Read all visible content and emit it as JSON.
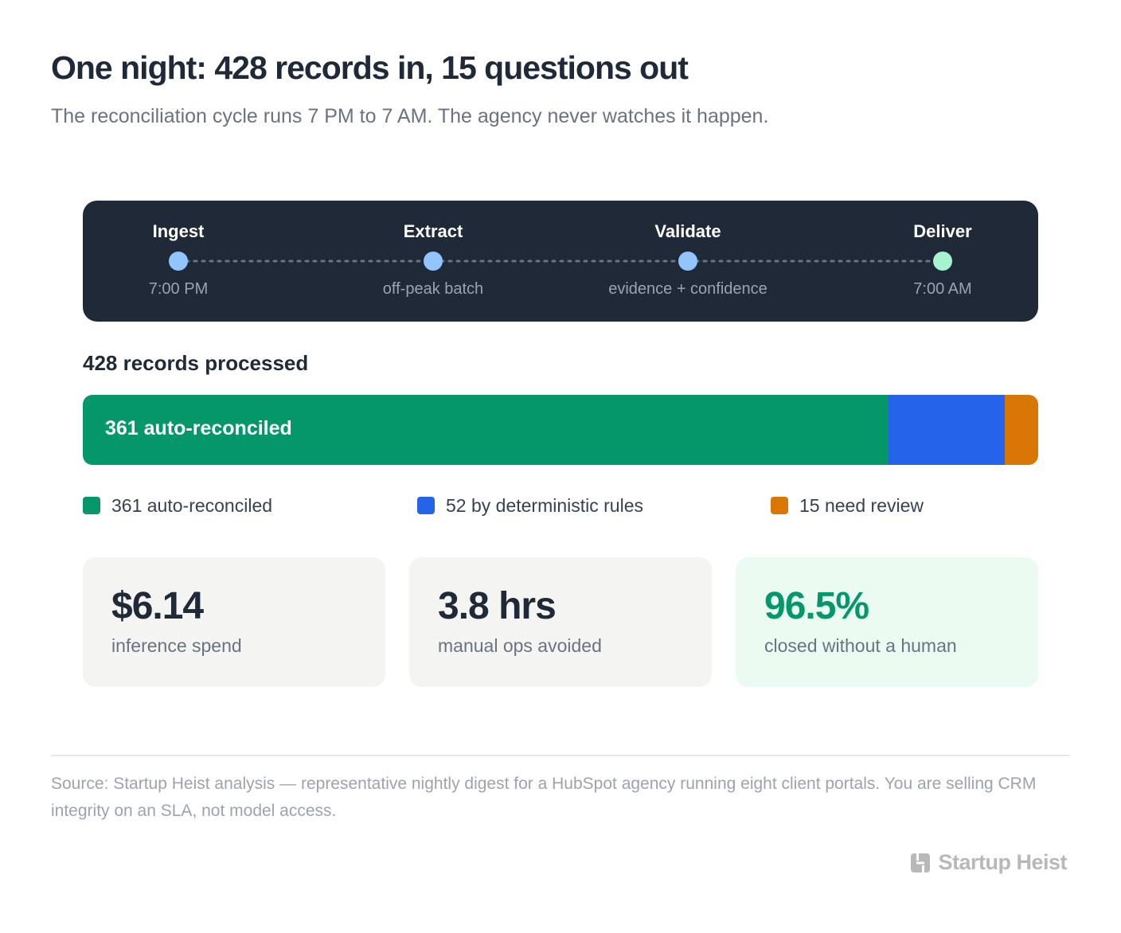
{
  "header": {
    "title": "One night: 428 records in, 15 questions out",
    "subtitle": "The reconciliation cycle runs 7 PM to 7 AM. The agency never watches it happen."
  },
  "timeline": {
    "stages": [
      {
        "name": "Ingest",
        "note": "7:00 PM",
        "color": "#93c5fd"
      },
      {
        "name": "Extract",
        "note": "off-peak batch",
        "color": "#93c5fd"
      },
      {
        "name": "Validate",
        "note": "evidence + confidence",
        "color": "#93c5fd"
      },
      {
        "name": "Deliver",
        "note": "7:00 AM",
        "color": "#a7f3d0"
      }
    ]
  },
  "records": {
    "label": "428 records processed",
    "bar_label": "361 auto-reconciled"
  },
  "chart_data": {
    "type": "bar",
    "orientation": "horizontal",
    "stacked": true,
    "total": 428,
    "segments": [
      {
        "label": "361 auto-reconciled",
        "value": 361,
        "color": "#059669"
      },
      {
        "label": "52 by deterministic rules",
        "value": 52,
        "color": "#2563eb"
      },
      {
        "label": "15 need review",
        "value": 15,
        "color": "#d97706"
      }
    ]
  },
  "legend": [
    {
      "label": "361 auto-reconciled",
      "color": "#059669"
    },
    {
      "label": "52 by deterministic rules",
      "color": "#2563eb"
    },
    {
      "label": "15 need review",
      "color": "#d97706"
    }
  ],
  "stats": [
    {
      "value": "$6.14",
      "label": "inference spend"
    },
    {
      "value": "3.8 hrs",
      "label": "manual ops avoided"
    },
    {
      "value": "96.5%",
      "label": "closed without a human"
    }
  ],
  "footer": {
    "source": "Source: Startup Heist analysis — representative nightly digest for a HubSpot agency running eight client portals. You are selling CRM integrity on an SLA, not model access.",
    "brand": "Startup Heist",
    "brand_icon": "startup-heist-logo-icon"
  },
  "colors": {
    "accent_green": "#059669",
    "accent_blue": "#2563eb",
    "accent_orange": "#d97706",
    "dark_panel": "#1f2937"
  }
}
